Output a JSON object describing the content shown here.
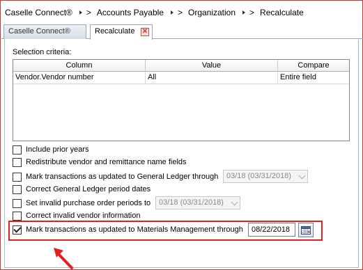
{
  "breadcrumb": {
    "items": [
      "Caselle Connect®",
      "Accounts Payable",
      "Organization",
      "Recalculate"
    ],
    "separator": ">"
  },
  "tabs": {
    "home_label": "Caselle Connect®",
    "active_label": "Recalculate",
    "close_glyph": "✕"
  },
  "selection": {
    "label": "Selection criteria:",
    "columns": [
      "Column",
      "Value",
      "Compare"
    ],
    "rows": [
      [
        "Vendor.Vendor number",
        "All",
        "Entire field"
      ]
    ]
  },
  "options": {
    "include_prior_years": {
      "label": "Include prior years",
      "checked": false
    },
    "redistribute": {
      "label": "Redistribute vendor and remittance name fields",
      "checked": false
    },
    "mark_gl": {
      "label": "Mark transactions as updated to General Ledger through",
      "checked": false,
      "period": "03/18 (03/31/2018)"
    },
    "correct_gl_dates": {
      "label": "Correct General Ledger period dates",
      "checked": false
    },
    "set_invalid_po": {
      "label": "Set invalid purchase order periods to",
      "checked": false,
      "period": "03/18 (03/31/2018)"
    },
    "correct_vendor": {
      "label": "Correct invalid vendor information",
      "checked": false
    },
    "mark_mm": {
      "label": "Mark transactions as updated to Materials Management through",
      "checked": true,
      "date": "08/22/2018"
    }
  },
  "colors": {
    "highlight": "#e02020",
    "accent_border": "#c23a34"
  },
  "icons": {
    "calendar": "calendar-icon",
    "close": "close-icon",
    "annotation_arrow": "red-arrow-icon"
  }
}
